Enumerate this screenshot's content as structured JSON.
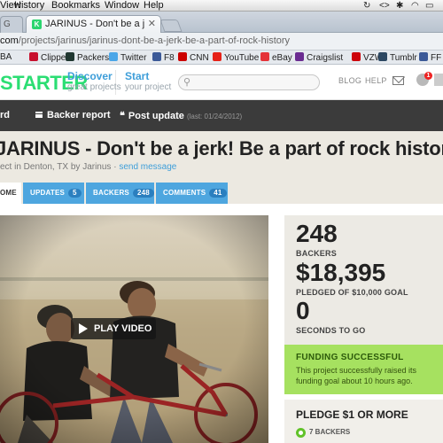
{
  "menubar": {
    "items": [
      "View",
      "History",
      "Bookmarks",
      "Window",
      "Help"
    ]
  },
  "browser": {
    "prev_tab_label": "G",
    "active_tab_title": "JARINUS - Don't be a jerk! Be a part of rock history!",
    "favicon_letter": "K",
    "url_host": "com",
    "url_path": "/projects/jarinus/jarinus-dont-be-a-jerk-be-a-part-of-rock-history",
    "bookmarks": [
      {
        "label": "BA",
        "color": "#1d4c8f"
      },
      {
        "label": "Clippers",
        "color": "#c8102e"
      },
      {
        "label": "Packers",
        "color": "#203731"
      },
      {
        "label": "Twitter",
        "color": "#4ba6e8"
      },
      {
        "label": "F8",
        "color": "#3b5998"
      },
      {
        "label": "CNN",
        "color": "#cc0000"
      },
      {
        "label": "YouTube",
        "color": "#e62117"
      },
      {
        "label": "eBay",
        "color": "#e53238"
      },
      {
        "label": "Craigslist",
        "color": "#6b2c91"
      },
      {
        "label": "VZW",
        "color": "#cd040b"
      },
      {
        "label": "Tumblr",
        "color": "#2c4762"
      },
      {
        "label": "FF H",
        "color": "#3b5998"
      }
    ]
  },
  "site": {
    "logo": "STARTER",
    "nav": [
      {
        "title": "Discover",
        "subtitle": "great projects"
      },
      {
        "title": "Start",
        "subtitle": "your project"
      }
    ],
    "blog": "BLOG",
    "help": "HELP",
    "notif_count": "1"
  },
  "toolbar": {
    "dashboard": "rd",
    "backer_report": "Backer report",
    "post_update": "Post update",
    "last_update": "(last: 01/24/2012)"
  },
  "project": {
    "title": "JARINUS - Don't be a jerk! Be a part of rock history!",
    "location_prefix": "ect in Denton, TX by Jarinus",
    "send_message": "send message",
    "tabs": [
      {
        "label": "OME",
        "count": null
      },
      {
        "label": "UPDATES",
        "count": "5"
      },
      {
        "label": "BACKERS",
        "count": "248"
      },
      {
        "label": "COMMENTS",
        "count": "41"
      }
    ],
    "play_video": "PLAY VIDEO",
    "stats": {
      "backers_value": "248",
      "backers_label": "BACKERS",
      "pledged_value": "$18,395",
      "pledged_label": "PLEDGED OF $10,000 GOAL",
      "seconds_value": "0",
      "seconds_label": "SECONDS TO GO"
    },
    "funding": {
      "heading": "FUNDING SUCCESSFUL",
      "body": "This project successfully raised its funding goal about 10 hours ago."
    },
    "pledge": {
      "heading": "PLEDGE $1 OR MORE",
      "backers": "7 BACKERS"
    }
  },
  "colors": {
    "kickstarter_green": "#2bde73",
    "link_blue": "#3e9ed9",
    "tab_blue": "#4ea6df",
    "funded_green": "#a6e160",
    "toolbar_dark": "#3b3b3b"
  }
}
